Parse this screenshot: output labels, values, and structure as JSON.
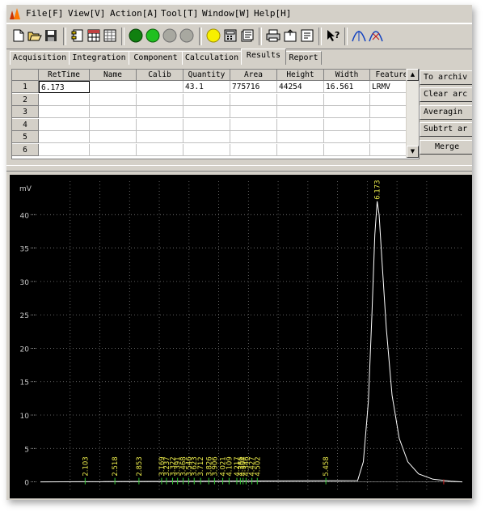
{
  "menu": [
    "File[F]",
    "View[V]",
    "Action[A]",
    "Tool[T]",
    "Window[W]",
    "Help[H]"
  ],
  "toolbar_icons": [
    "new-icon",
    "open-icon",
    "save-icon",
    "method-icon",
    "table-icon",
    "grid-icon",
    "start-acq-icon",
    "run-icon",
    "stop-icon",
    "pause-icon",
    "light-icon",
    "calculator-icon",
    "report-icon",
    "print-icon",
    "export-icon",
    "import-icon",
    "whats-this-icon",
    "peak-mark-icon",
    "peak-split-icon"
  ],
  "tabs": [
    "Acquisition",
    "Integration",
    "Component",
    "Calculation",
    "Results",
    "Report"
  ],
  "active_tab": "Results",
  "table": {
    "columns": [
      "RetTime",
      "Name",
      "Calib",
      "Quantity",
      "Area",
      "Height",
      "Width",
      "Feature"
    ],
    "row_numbers": [
      "1",
      "2",
      "3",
      "4",
      "5",
      "6"
    ],
    "rows": [
      [
        "6.173",
        "",
        "",
        "43.1",
        "775716",
        "44254",
        "16.561",
        "LRMV"
      ],
      [
        "",
        "",
        "",
        "",
        "",
        "",
        "",
        ""
      ],
      [
        "",
        "",
        "",
        "",
        "",
        "",
        "",
        ""
      ],
      [
        "",
        "",
        "",
        "",
        "",
        "",
        "",
        ""
      ],
      [
        "",
        "",
        "",
        "",
        "",
        "",
        "",
        ""
      ],
      [
        "",
        "",
        "",
        "",
        "",
        "",
        "",
        ""
      ]
    ]
  },
  "side_buttons": [
    "To archiv",
    "Clear arc",
    "Averagin",
    "Subtrt ar",
    "Merge"
  ],
  "chart_data": {
    "type": "line",
    "ylabel": "mV",
    "ylim": [
      -1.5,
      45
    ],
    "xlim": [
      1.48,
      7.36
    ],
    "yticks": [
      "40",
      "35",
      "30",
      "25",
      "20",
      "15",
      "10",
      "5",
      "0"
    ],
    "grid": true,
    "colors": {
      "background": "#000000",
      "grid": "#7a7a7a",
      "trace": "#ffffff",
      "peak_label": "#e8e84a",
      "marker": "#33cc33",
      "axis_text": "#c8c8c8"
    },
    "series": [
      {
        "name": "",
        "x": [
          1.48,
          5.9,
          5.98,
          6.05,
          6.1,
          6.14,
          6.173,
          6.2,
          6.24,
          6.3,
          6.38,
          6.48,
          6.6,
          6.75,
          6.95,
          7.2,
          7.36
        ],
        "y": [
          0,
          0.2,
          3,
          12,
          25,
          37,
          42,
          40,
          33,
          23,
          13,
          6.5,
          3,
          1.2,
          0.4,
          0.1,
          0
        ]
      }
    ],
    "peak_labels": [
      "2.103",
      "2.518",
      "2.853",
      "3.169",
      "3.237",
      "3.322",
      "3.391",
      "3.468",
      "3.546",
      "3.623",
      "3.712",
      "3.826",
      "3.906",
      "4.021",
      "4.109",
      "4.217",
      "4.266",
      "4.304",
      "4.346",
      "4.427",
      "4.502",
      "5.458",
      "6.173"
    ],
    "peak_times": [
      2.103,
      2.518,
      2.853,
      3.169,
      3.237,
      3.322,
      3.391,
      3.468,
      3.546,
      3.623,
      3.712,
      3.826,
      3.906,
      4.021,
      4.109,
      4.217,
      4.266,
      4.304,
      4.346,
      4.427,
      4.502,
      5.458,
      6.173
    ]
  }
}
